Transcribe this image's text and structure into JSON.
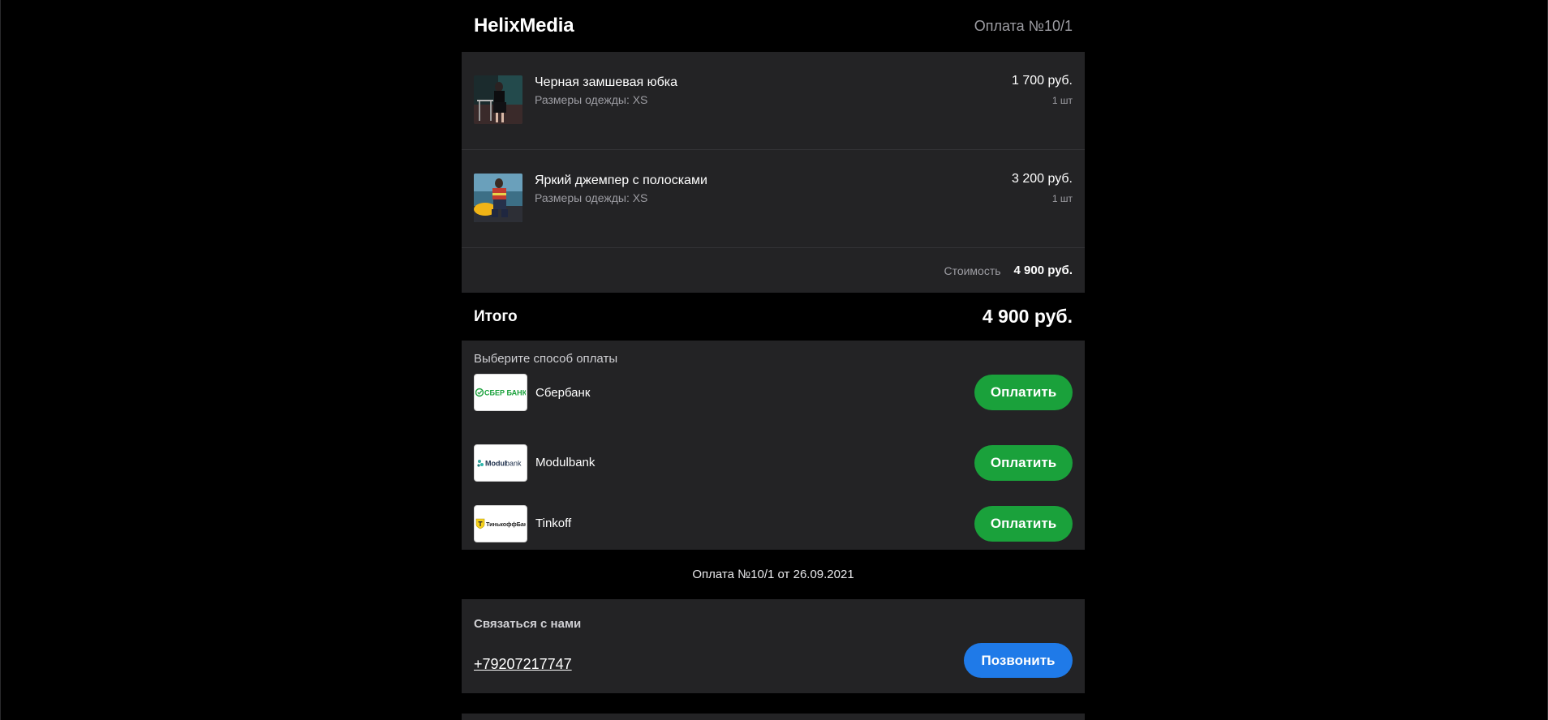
{
  "header": {
    "brand": "HelixMedia",
    "order_number": "Оплата №10/1"
  },
  "cart": {
    "items": [
      {
        "name": "Черная замшевая юбка",
        "size": "Размеры одежды: XS",
        "price": "1 700 руб.",
        "qty": "1 шт"
      },
      {
        "name": "Яркий джемпер с полосками",
        "size": "Размеры одежды: XS",
        "price": "3 200 руб.",
        "qty": "1 шт"
      }
    ],
    "cost_label": "Стоимость",
    "cost_value": "4 900 руб."
  },
  "total": {
    "label": "Итого",
    "value": "4 900 руб."
  },
  "payment": {
    "title": "Выберите способ оплаты",
    "methods": [
      {
        "name": "Сбербанк",
        "button": "Оплатить",
        "logo": "sberbank-logo"
      },
      {
        "name": "Modulbank",
        "button": "Оплатить",
        "logo": "modulbank-logo"
      },
      {
        "name": "Tinkoff",
        "button": "Оплатить",
        "logo": "tinkoff-logo"
      }
    ],
    "logos": {
      "sber": "СБЕР БАНК",
      "modul_a": "Modul",
      "modul_b": "bank",
      "tinkoff": "ТинькоффБанк"
    },
    "button_color": "#1aa13b"
  },
  "order_footer": "Оплата №10/1 от 26.09.2021",
  "contact": {
    "title": "Связаться с нами",
    "phone": "+79207217747",
    "call_button": "Позвонить",
    "call_color": "#1f7ae8"
  }
}
